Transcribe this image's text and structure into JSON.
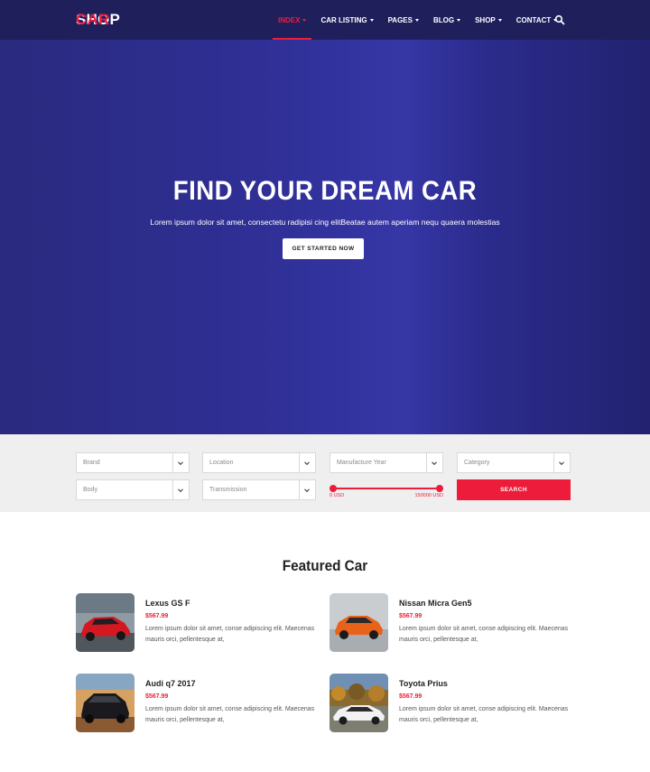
{
  "brand": {
    "part1": "CAR",
    "part2": "SHOP"
  },
  "nav": {
    "items": [
      {
        "label": "INDEX",
        "active": true
      },
      {
        "label": "CAR LISTING",
        "active": false
      },
      {
        "label": "PAGES",
        "active": false
      },
      {
        "label": "BLOG",
        "active": false
      },
      {
        "label": "SHOP",
        "active": false
      },
      {
        "label": "CONTACT",
        "active": false
      }
    ],
    "search_icon": "search-icon"
  },
  "hero": {
    "title": "FIND YOUR DREAM CAR",
    "subtitle": "Lorem ipsum dolor sit amet, consectetu radipisi cing elitBeatae autem aperiam nequ quaera molestias",
    "button_label": "GET STARTED NOW"
  },
  "filters": {
    "brand": "Brand",
    "location": "Location",
    "year": "Manufacture Year",
    "category": "Category",
    "body": "Body",
    "transmission": "Transmission",
    "price_min": "0 USD",
    "price_max": "150000 USD",
    "search_label": "SEARCH"
  },
  "featured": {
    "title": "Featured Car",
    "cars": [
      {
        "name": "Lexus GS F",
        "price": "$567.99",
        "desc": "Lorem ipsum dolor sit amet, conse adipiscing elit. Maecenas mauris orci, pellentesque at,"
      },
      {
        "name": "Nissan Micra Gen5",
        "price": "$567.99",
        "desc": "Lorem ipsum dolor sit amet, conse adipiscing elit. Maecenas mauris orci, pellentesque at,"
      },
      {
        "name": "Audi q7 2017",
        "price": "$567.99",
        "desc": "Lorem ipsum dolor sit amet, conse adipiscing elit. Maecenas mauris orci, pellentesque at,"
      },
      {
        "name": "Toyota Prius",
        "price": "$567.99",
        "desc": "Lorem ipsum dolor sit amet, conse adipiscing elit. Maecenas mauris orci, pellentesque at,"
      }
    ]
  },
  "colors": {
    "accent": "#ee1c3b",
    "header": "#1f1f5c",
    "hero": "#2f2f96"
  }
}
